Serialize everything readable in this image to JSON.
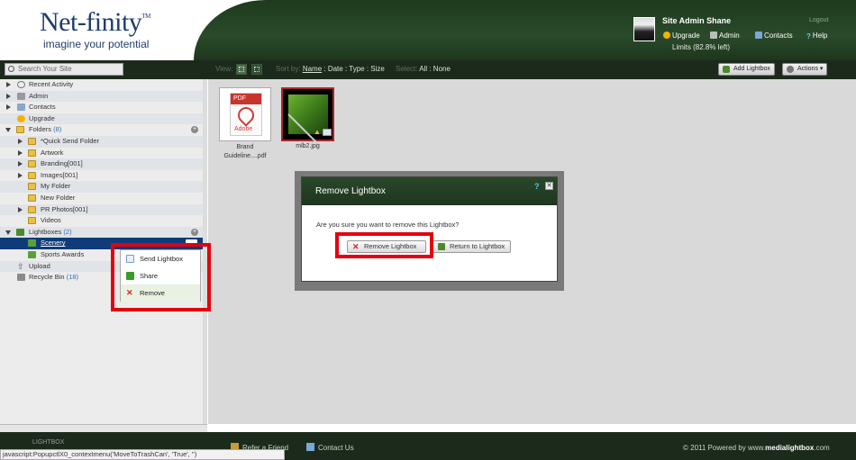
{
  "header": {
    "logo_text": "Net-finity",
    "logo_tm": "TM",
    "tagline": "imagine your potential",
    "user_name": "Site Admin Shane",
    "logout": "Logout",
    "links": {
      "upgrade": "Upgrade",
      "admin": "Admin",
      "contacts": "Contacts",
      "help": "Help"
    },
    "limits": "Limits (82.8% left)"
  },
  "toolbar": {
    "search_placeholder": "Search Your Site",
    "view_label": "View:",
    "sort_label": "Sort by:",
    "sort_name": "Name",
    "sort_rest": " : Date : Type : Size",
    "select_label": "Select:",
    "select_all": "All",
    "select_none": " : None",
    "add_lightbox": "Add Lightbox",
    "actions": "Actions"
  },
  "sidebar": {
    "items": [
      {
        "label": "Recent Activity"
      },
      {
        "label": "Admin"
      },
      {
        "label": "Contacts"
      },
      {
        "label": "Upgrade"
      },
      {
        "label": "Folders",
        "count": "(8)"
      },
      {
        "label": "*Quick Send Folder"
      },
      {
        "label": "Artwork"
      },
      {
        "label": "Branding[001]"
      },
      {
        "label": "Images[001]"
      },
      {
        "label": "My Folder"
      },
      {
        "label": "New Folder"
      },
      {
        "label": "PR Photos[001]"
      },
      {
        "label": "Videos"
      },
      {
        "label": "Lightboxes",
        "count": "(2)"
      },
      {
        "label": "Scenery"
      },
      {
        "label": "Sports Awards"
      },
      {
        "label": "Upload"
      },
      {
        "label": "Recycle Bin",
        "count": "(18)"
      }
    ]
  },
  "files": [
    {
      "name_line1": "Brand",
      "name_line2": "Guideline....pdf",
      "badge": "PDF",
      "brand": "Adobe"
    },
    {
      "name_line1": "mlb2.jpg",
      "name_line2": ""
    }
  ],
  "modal": {
    "title": "Remove Lightbox",
    "help": "?",
    "close": "✕",
    "message": "Are you sure you want to remove this Lightbox?",
    "confirm": "Remove Lightbox",
    "cancel": "Return to Lightbox"
  },
  "context_menu": {
    "items": [
      "Send Lightbox",
      "Share",
      "Remove"
    ]
  },
  "footer": {
    "refer": "Refer a Friend",
    "contact": "Contact Us",
    "copyright_prefix": "© 2011 Powered by www.",
    "copyright_brand": "medialightbox",
    "copyright_suffix": ".com",
    "status": "javascript:PopupctlX0_contextmenu('MoveToTrashCan', 'True', '')",
    "logo_text": "LIGHTBOX"
  },
  "colors": {
    "brand_green": "#1e3a1e",
    "highlight_red": "#e3000f",
    "selected_blue": "#0f3c78"
  }
}
